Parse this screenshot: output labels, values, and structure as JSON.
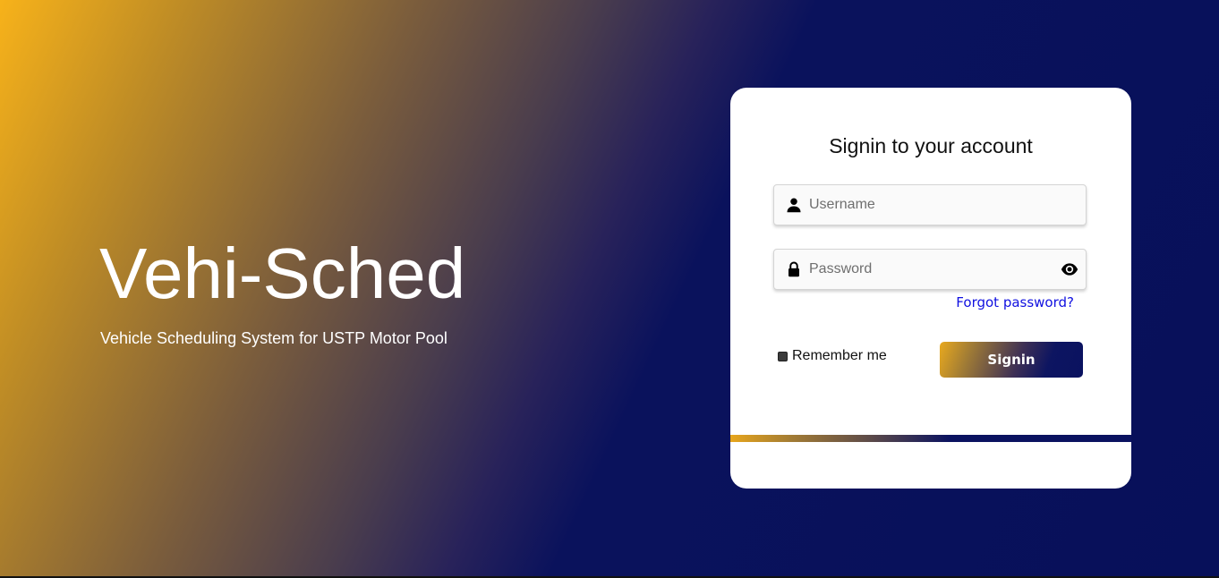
{
  "hero": {
    "title": "Vehi-Sched",
    "subtitle": "Vehicle Scheduling System for USTP Motor Pool"
  },
  "login": {
    "heading": "Signin to your account",
    "username": {
      "placeholder": "Username",
      "value": "",
      "icon": "user-icon"
    },
    "password": {
      "placeholder": "Password",
      "value": "",
      "icon": "lock-icon",
      "toggle_icon": "eye-icon"
    },
    "forgot_link": "Forgot password?",
    "remember_label": "Remember me",
    "remember_checked": false,
    "signin_label": "Signin"
  },
  "colors": {
    "gold": "#f7b21a",
    "navy": "#07105a",
    "link": "#1010e0"
  }
}
